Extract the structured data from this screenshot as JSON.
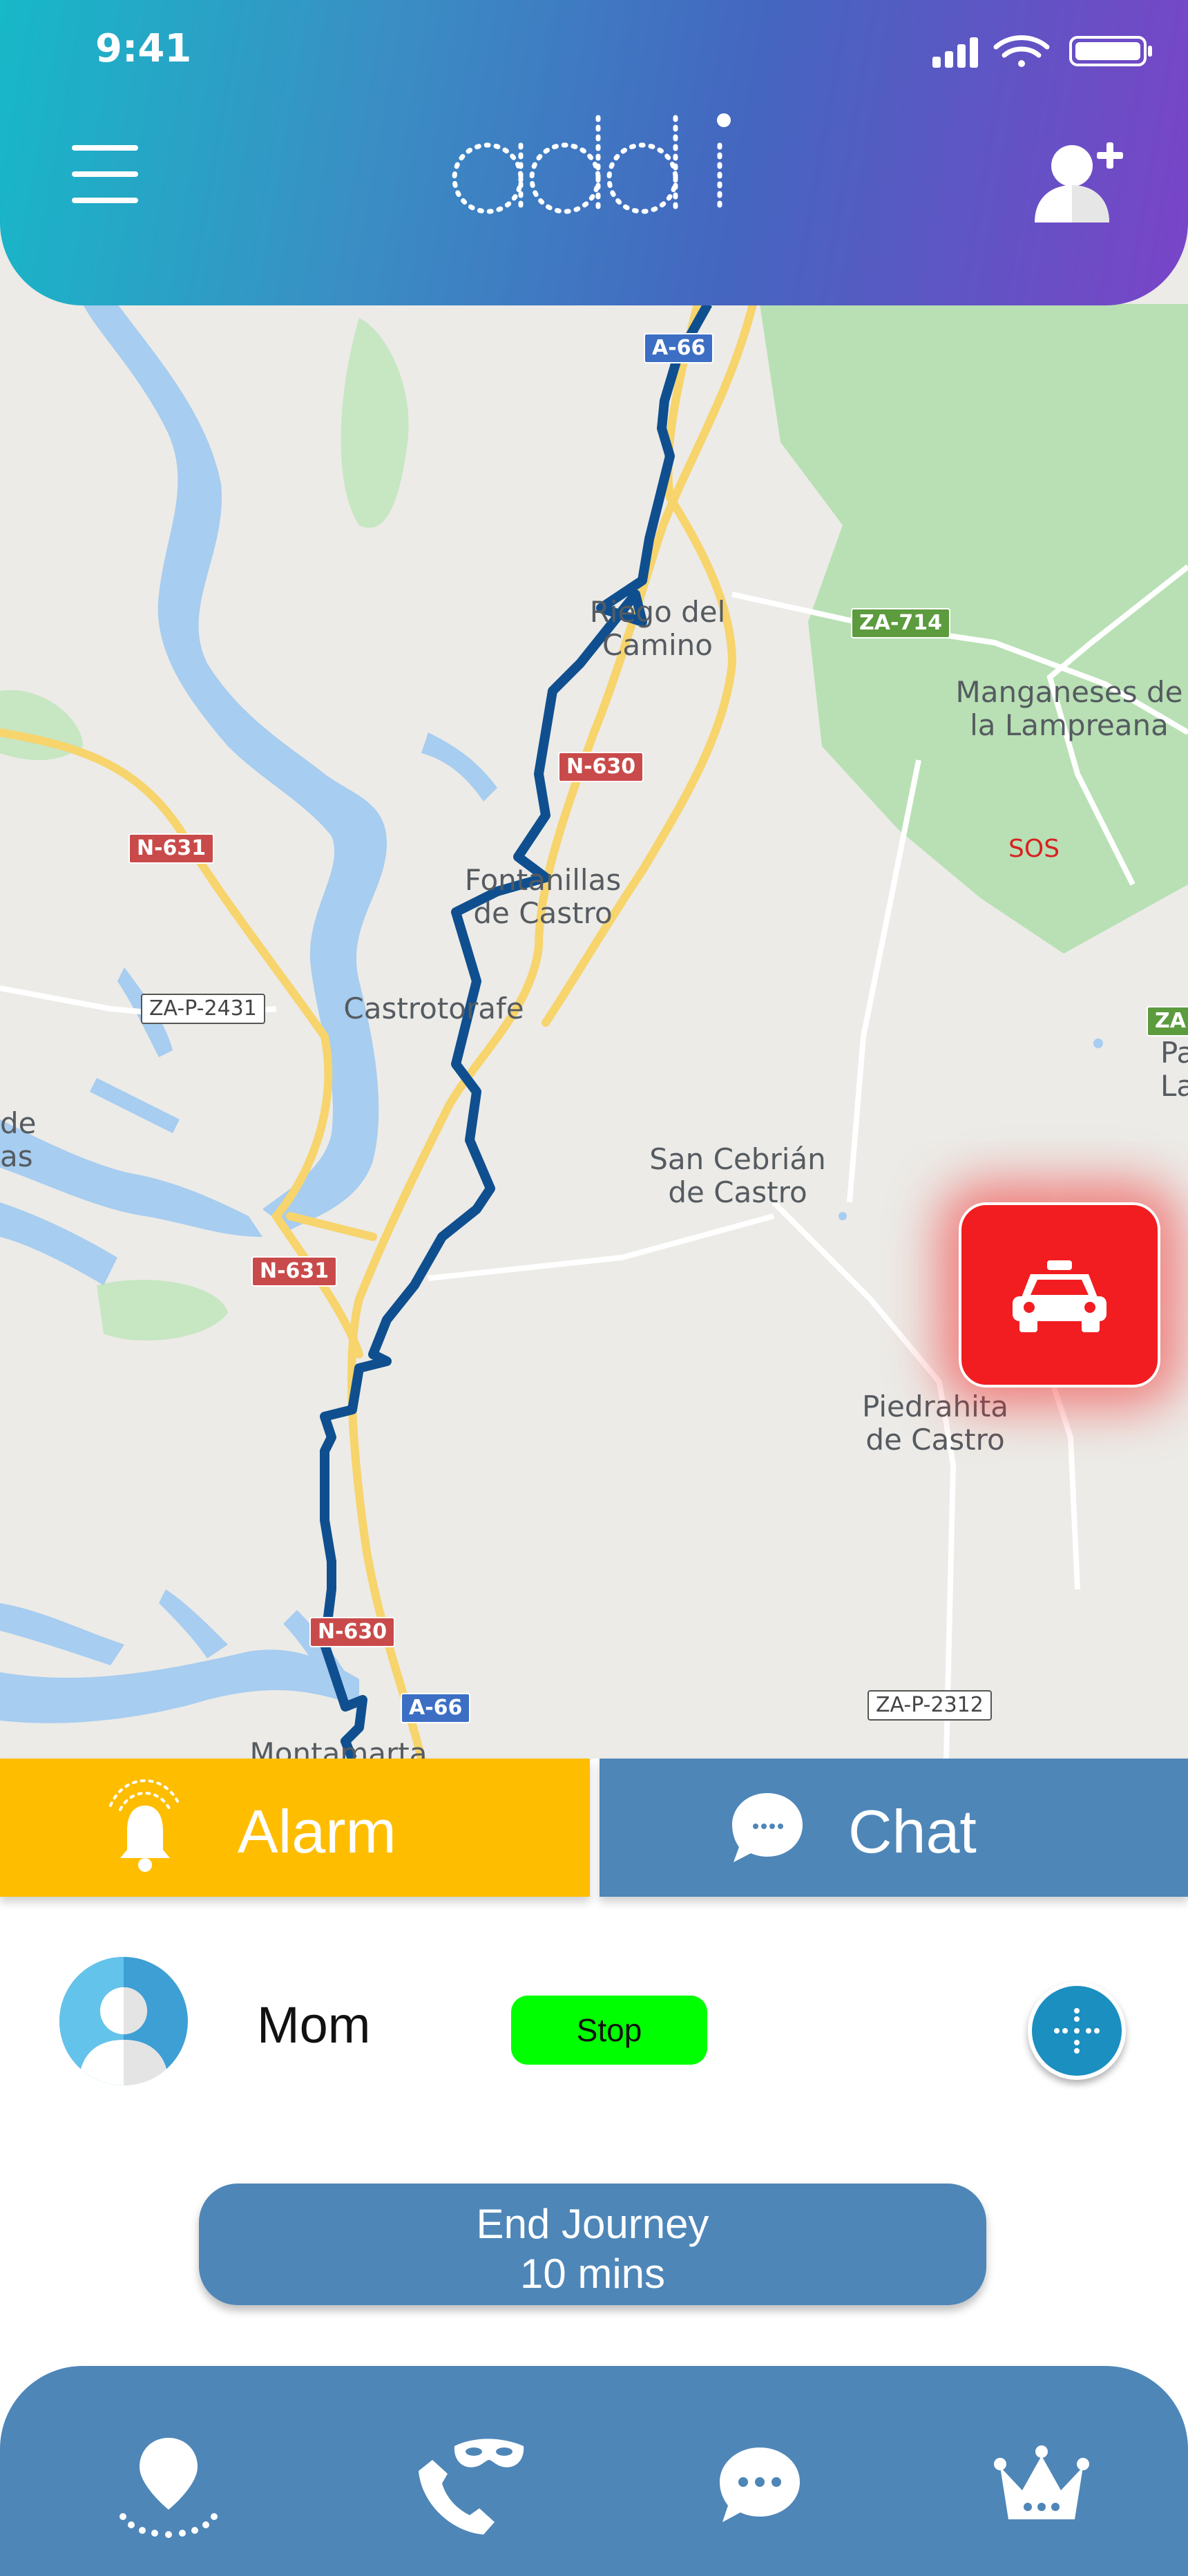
{
  "status_bar": {
    "time": "9:41"
  },
  "header": {
    "logo_text": "addi"
  },
  "map": {
    "places": [
      {
        "id": "riego",
        "lines": [
          "Riego del",
          "Camino"
        ]
      },
      {
        "id": "manganeses",
        "lines": [
          "Manganeses de",
          "la Lampreana"
        ]
      },
      {
        "id": "fontanillas",
        "lines": [
          "Fontanillas",
          "de Castro"
        ]
      },
      {
        "id": "castrotorafe",
        "lines": [
          "Castrotorafe"
        ]
      },
      {
        "id": "san-cebrian",
        "lines": [
          "San Cebrián",
          "de Castro"
        ]
      },
      {
        "id": "piedrahita",
        "lines": [
          "Piedrahita",
          "de Castro"
        ]
      },
      {
        "id": "montamarta",
        "lines": [
          "Montamarta"
        ]
      },
      {
        "id": "pajares",
        "lines": [
          "Pajare",
          "Lamp"
        ]
      },
      {
        "id": "de-left",
        "lines": [
          "de",
          "as"
        ]
      }
    ],
    "roads": {
      "a66_top": "A-66",
      "za714": "ZA-714",
      "n630_a": "N-630",
      "n631_a": "N-631",
      "zap2431": "ZA-P-2431",
      "za_right": "ZA",
      "n631_b": "N-631",
      "n630_b": "N-630",
      "a66_bottom": "A-66",
      "zap2312": "ZA-P-2312"
    },
    "sos_label": "SOS"
  },
  "actions": {
    "alarm_label": "Alarm",
    "chat_label": "Chat",
    "alarm_color": "#ffbd00",
    "chat_color": "#4e86b8"
  },
  "contact": {
    "name": "Mom",
    "status": "Stop",
    "status_color": "#00ff00"
  },
  "journey": {
    "end_label": "End Journey",
    "duration": "10 mins"
  },
  "bottom_nav": {
    "items": [
      "location-pin-icon",
      "phone-mask-icon",
      "chat-bubble-icon",
      "crown-icon"
    ]
  },
  "colors": {
    "header_gradient": [
      "#17b8c8",
      "#4466c0",
      "#7a44c8"
    ],
    "taxi_button": "#f21d20",
    "route": "#0f4f8f"
  }
}
